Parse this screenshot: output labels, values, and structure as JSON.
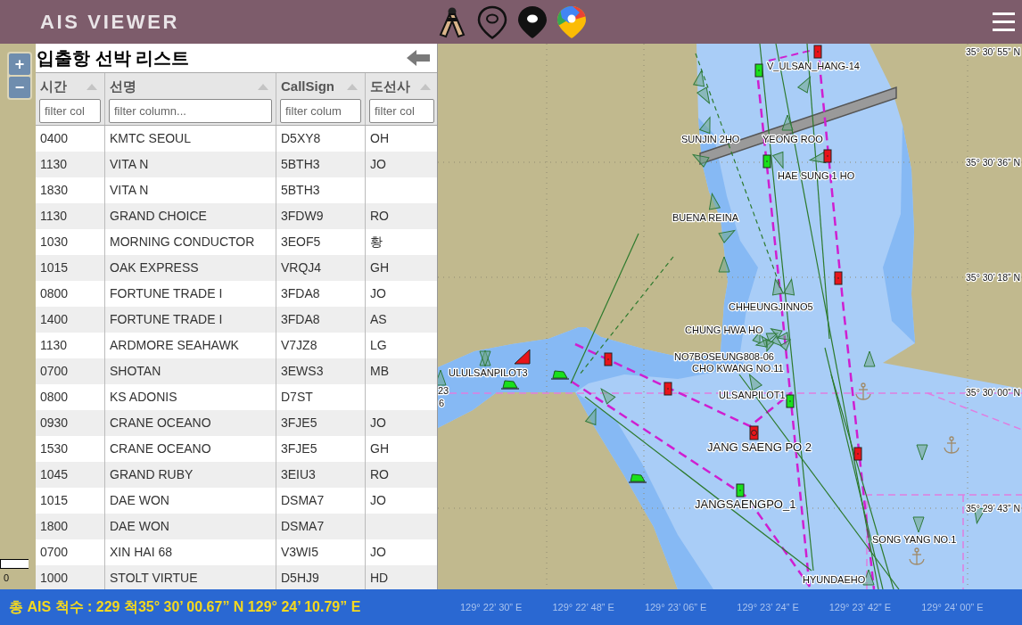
{
  "header": {
    "title": "AIS VIEWER"
  },
  "zoom_controls": [
    "+",
    "−"
  ],
  "scale_bar": {
    "label": "0"
  },
  "panel": {
    "title": "입출항 선박 리스트",
    "columns": [
      {
        "label": "시간",
        "placeholder": "filter col"
      },
      {
        "label": "선명",
        "placeholder": "filter column..."
      },
      {
        "label": "CallSign",
        "placeholder": "filter colum"
      },
      {
        "label": "도선사",
        "placeholder": "filter col"
      }
    ],
    "rows": [
      {
        "time": "0400",
        "name": "KMTC SEOUL",
        "callsign": "D5XY8",
        "pilot": "OH"
      },
      {
        "time": "1130",
        "name": "VITA N",
        "callsign": "5BTH3",
        "pilot": "JO"
      },
      {
        "time": "1830",
        "name": "VITA N",
        "callsign": "5BTH3"
      },
      {
        "time": "1130",
        "name": "GRAND CHOICE",
        "callsign": "3FDW9",
        "pilot": "RO"
      },
      {
        "time": "1030",
        "name": "MORNING CONDUCTOR",
        "callsign": "3EOF5",
        "pilot": "황"
      },
      {
        "time": "1015",
        "name": "OAK EXPRESS",
        "callsign": "VRQJ4",
        "pilot": "GH"
      },
      {
        "time": "0800",
        "name": "FORTUNE TRADE I",
        "callsign": "3FDA8",
        "pilot": "JO"
      },
      {
        "time": "1400",
        "name": "FORTUNE TRADE I",
        "callsign": "3FDA8",
        "pilot": "AS"
      },
      {
        "time": "1130",
        "name": "ARDMORE SEAHAWK",
        "callsign": "V7JZ8",
        "pilot": "LG"
      },
      {
        "time": "0700",
        "name": "SHOTAN",
        "callsign": "3EWS3",
        "pilot": "MB"
      },
      {
        "time": "0800",
        "name": "KS ADONIS",
        "callsign": "D7ST"
      },
      {
        "time": "0930",
        "name": "CRANE OCEANO",
        "callsign": "3FJE5",
        "pilot": "JO"
      },
      {
        "time": "1530",
        "name": "CRANE OCEANO",
        "callsign": "3FJE5",
        "pilot": "GH"
      },
      {
        "time": "1045",
        "name": "GRAND RUBY",
        "callsign": "3EIU3",
        "pilot": "RO"
      },
      {
        "time": "1015",
        "name": "DAE WON",
        "callsign": "DSMA7",
        "pilot": "JO"
      },
      {
        "time": "1800",
        "name": "DAE WON",
        "callsign": "DSMA7"
      },
      {
        "time": "0700",
        "name": "XIN HAI 68",
        "callsign": "V3WI5",
        "pilot": "JO"
      },
      {
        "time": "1000",
        "name": "STOLT VIRTUE",
        "callsign": "D5HJ9",
        "pilot": "HD"
      }
    ]
  },
  "map": {
    "vessel_labels": [
      "V_ULSAN_HANG-14",
      "SUNJIN 2HO",
      "YEONG ROO",
      "HAE SUNG 1 HO",
      "BUENA REINA",
      "CHHEUNGJINNO5",
      "CHUNG HWA HO",
      "NO7BOSEUNG808-06",
      "CHO KWANG NO.11",
      "ULULSANPILOT3",
      "23",
      "6",
      "ULSANPILOT1",
      "JANG SAENG PO 2",
      "JANGSAENGPO_1",
      "SONG YANG NO.1",
      "HYUNDAEHO"
    ],
    "latitude_labels": [
      "35° 30’ 55” N",
      "35° 30’ 36” N",
      "35° 30’ 18” N",
      "35° 30’ 00” N",
      "35° 29’ 43” N"
    ]
  },
  "status_bar": {
    "vessel_count": "총 AIS 척수 : 229 척",
    "cursor_position": "35° 30’ 00.67” N 129° 24’ 10.79” E",
    "longitude_labels": [
      "129° 22’ 30” E",
      "129° 22’ 48” E",
      "129° 23’ 06” E",
      "129° 23’ 24” E",
      "129° 23’ 42” E",
      "129° 24’ 00” E"
    ]
  }
}
